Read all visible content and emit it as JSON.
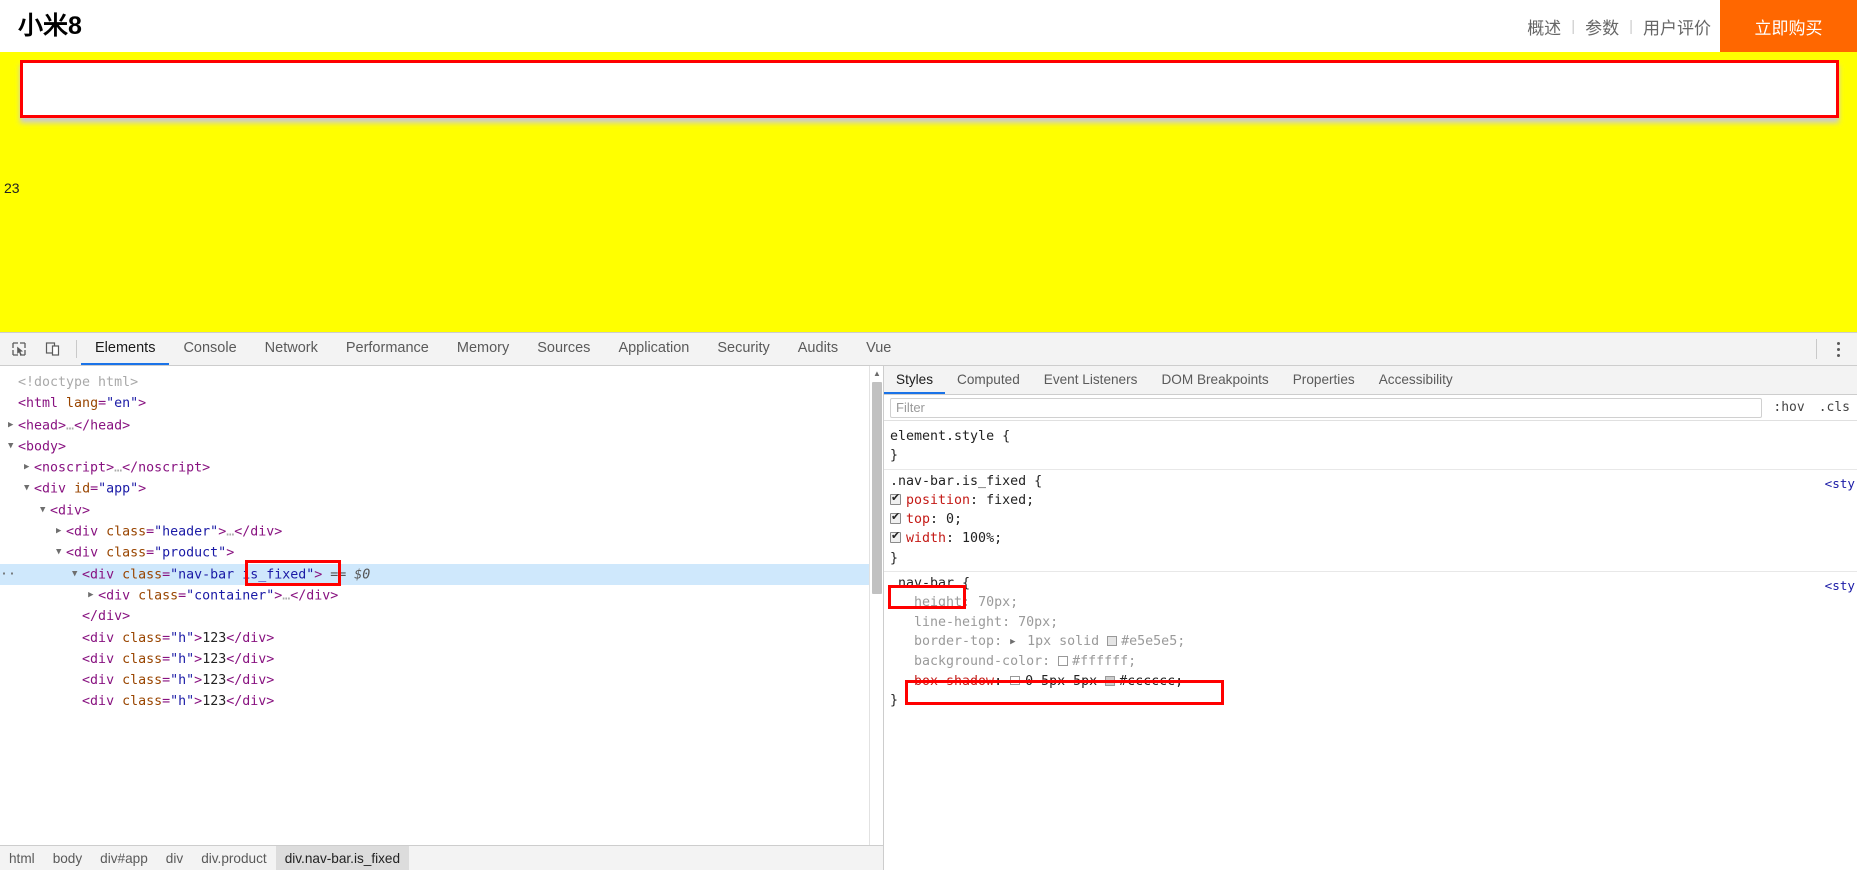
{
  "page": {
    "logo": "小米8",
    "nav": [
      {
        "label": "概述"
      },
      {
        "label": "参数"
      },
      {
        "label": "用户评价"
      }
    ],
    "separator": "|",
    "buy_button": "立即购买",
    "body_text": "23",
    "colors": {
      "buy_button_bg": "#ff6700",
      "page_bg": "#ffff00",
      "highlight_outline": "#ff0000",
      "navbar_bg": "#ffffff"
    }
  },
  "devtools": {
    "toolbar_icons": [
      {
        "name": "inspect-element-icon"
      },
      {
        "name": "device-toolbar-icon"
      }
    ],
    "tabs": [
      {
        "label": "Elements",
        "active": true
      },
      {
        "label": "Console",
        "active": false
      },
      {
        "label": "Network",
        "active": false
      },
      {
        "label": "Performance",
        "active": false
      },
      {
        "label": "Memory",
        "active": false
      },
      {
        "label": "Sources",
        "active": false
      },
      {
        "label": "Application",
        "active": false
      },
      {
        "label": "Security",
        "active": false
      },
      {
        "label": "Audits",
        "active": false
      },
      {
        "label": "Vue",
        "active": false
      }
    ],
    "more_menu_icon": "kebab-menu-icon",
    "dom_rows": [
      {
        "indent": 0,
        "arrow": "",
        "html": "<span class=\"dtd\">&lt;!doctype html&gt;</span>",
        "selected": false
      },
      {
        "indent": 0,
        "arrow": "",
        "html": "<span class=\"tw\">&lt;html</span> <span class=\"at\">lang</span><span class=\"tw\">=</span><span class=\"av\">\"en\"</span><span class=\"tw\">&gt;</span>",
        "selected": false
      },
      {
        "indent": 0,
        "arrow": "▶",
        "html": "<span class=\"tw\">&lt;head&gt;</span><span class=\"dtd\">…</span><span class=\"tw\">&lt;/head&gt;</span>",
        "selected": false
      },
      {
        "indent": 0,
        "arrow": "▼",
        "html": "<span class=\"tw\">&lt;body&gt;</span>",
        "selected": false
      },
      {
        "indent": 1,
        "arrow": "▶",
        "html": "<span class=\"tw\">&lt;noscript&gt;</span><span class=\"dtd\">…</span><span class=\"tw\">&lt;/noscript&gt;</span>",
        "selected": false
      },
      {
        "indent": 1,
        "arrow": "▼",
        "html": "<span class=\"tw\">&lt;div</span> <span class=\"at\">id</span><span class=\"tw\">=</span><span class=\"av\">\"app\"</span><span class=\"tw\">&gt;</span>",
        "selected": false
      },
      {
        "indent": 2,
        "arrow": "▼",
        "html": "<span class=\"tw\">&lt;div&gt;</span>",
        "selected": false
      },
      {
        "indent": 3,
        "arrow": "▶",
        "html": "<span class=\"tw\">&lt;div</span> <span class=\"at\">class</span><span class=\"tw\">=</span><span class=\"av\">\"header\"</span><span class=\"tw\">&gt;</span><span class=\"dtd\">…</span><span class=\"tw\">&lt;/div&gt;</span>",
        "selected": false
      },
      {
        "indent": 3,
        "arrow": "▼",
        "html": "<span class=\"tw\">&lt;div</span> <span class=\"at\">class</span><span class=\"tw\">=</span><span class=\"av\">\"product\"</span><span class=\"tw\">&gt;</span>",
        "selected": false
      },
      {
        "indent": 4,
        "arrow": "▼",
        "html": "<span class=\"tw\">&lt;div</span> <span class=\"at\">class</span><span class=\"tw\">=</span><span class=\"av\">\"nav-bar is_fixed\"</span><span class=\"tw\">&gt;</span> <span class=\"dollar\">== $0</span>",
        "selected": true
      },
      {
        "indent": 5,
        "arrow": "▶",
        "html": "<span class=\"tw\">&lt;div</span> <span class=\"at\">class</span><span class=\"tw\">=</span><span class=\"av\">\"container\"</span><span class=\"tw\">&gt;</span><span class=\"dtd\">…</span><span class=\"tw\">&lt;/div&gt;</span>",
        "selected": false
      },
      {
        "indent": 4,
        "arrow": "",
        "html": "<span class=\"tw\">&lt;/div&gt;</span>",
        "selected": false
      },
      {
        "indent": 4,
        "arrow": "",
        "html": "<span class=\"tw\">&lt;div</span> <span class=\"at\">class</span><span class=\"tw\">=</span><span class=\"av\">\"h\"</span><span class=\"tw\">&gt;</span><span class=\"tx\">123</span><span class=\"tw\">&lt;/div&gt;</span>",
        "selected": false
      },
      {
        "indent": 4,
        "arrow": "",
        "html": "<span class=\"tw\">&lt;div</span> <span class=\"at\">class</span><span class=\"tw\">=</span><span class=\"av\">\"h\"</span><span class=\"tw\">&gt;</span><span class=\"tx\">123</span><span class=\"tw\">&lt;/div&gt;</span>",
        "selected": false
      },
      {
        "indent": 4,
        "arrow": "",
        "html": "<span class=\"tw\">&lt;div</span> <span class=\"at\">class</span><span class=\"tw\">=</span><span class=\"av\">\"h\"</span><span class=\"tw\">&gt;</span><span class=\"tx\">123</span><span class=\"tw\">&lt;/div&gt;</span>",
        "selected": false
      },
      {
        "indent": 4,
        "arrow": "",
        "html": "<span class=\"tw\">&lt;div</span> <span class=\"at\">class</span><span class=\"tw\">=</span><span class=\"av\">\"h\"</span><span class=\"tw\">&gt;</span><span class=\"tx\">123</span><span class=\"tw\">&lt;/div&gt;</span>",
        "selected": false
      }
    ],
    "breadcrumb": [
      {
        "label": "html",
        "active": false
      },
      {
        "label": "body",
        "active": false
      },
      {
        "label": "div#app",
        "active": false
      },
      {
        "label": "div",
        "active": false
      },
      {
        "label": "div.product",
        "active": false
      },
      {
        "label": "div.nav-bar.is_fixed",
        "active": true
      }
    ],
    "sidebar_tabs": [
      {
        "label": "Styles",
        "active": true
      },
      {
        "label": "Computed",
        "active": false
      },
      {
        "label": "Event Listeners",
        "active": false
      },
      {
        "label": "DOM Breakpoints",
        "active": false
      },
      {
        "label": "Properties",
        "active": false
      },
      {
        "label": "Accessibility",
        "active": false
      }
    ],
    "filter": {
      "placeholder": "Filter",
      "value": ""
    },
    "hov_button": ":hov",
    "cls_button": ".cls",
    "css_rules": [
      {
        "selector": "element.style {",
        "close": "}",
        "source": "",
        "declarations": []
      },
      {
        "selector": ".nav-bar.is_fixed {",
        "close": "}",
        "source": "<sty",
        "declarations": [
          {
            "checkbox": true,
            "property": "position",
            "value": "fixed;"
          },
          {
            "checkbox": true,
            "property": "top",
            "value": "0;"
          },
          {
            "checkbox": true,
            "property": "width",
            "value": "100%;"
          }
        ]
      },
      {
        "selector": ".nav-bar {",
        "close": "}",
        "source": "<sty",
        "declarations": [
          {
            "checkbox": false,
            "property": "height",
            "value": "70px;",
            "dim": true
          },
          {
            "checkbox": false,
            "property": "line-height",
            "value": "70px;",
            "dim": true
          },
          {
            "checkbox": false,
            "property": "border-top",
            "value": "1px solid #e5e5e5;",
            "dim": true,
            "tri": true,
            "swatch": "#e5e5e5"
          },
          {
            "checkbox": false,
            "property": "background-color",
            "value": "#ffffff;",
            "dim": true,
            "swatch": "#ffffff"
          },
          {
            "checkbox": false,
            "property": "box-shadow",
            "value": "0 5px 5px #cccccc;",
            "dim": false,
            "shadow": true,
            "swatch": "#cccccc"
          }
        ]
      }
    ]
  }
}
